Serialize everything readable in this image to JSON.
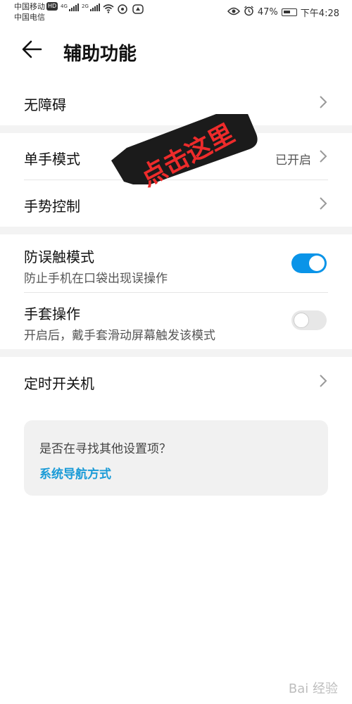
{
  "status": {
    "carrier1": "中国移动",
    "carrier2": "中国电信",
    "hd_badge": "HD",
    "net1": "4G",
    "net2": "2G",
    "battery_pct": "47%",
    "time": "下午4:28"
  },
  "header": {
    "title": "辅助功能"
  },
  "items": {
    "accessibility": {
      "label": "无障碍"
    },
    "one_hand": {
      "label": "单手模式",
      "value": "已开启"
    },
    "gesture": {
      "label": "手势控制"
    },
    "anti_touch": {
      "label": "防误触模式",
      "desc": "防止手机在口袋出现误操作",
      "enabled": true
    },
    "glove": {
      "label": "手套操作",
      "desc": "开启后，戴手套滑动屏幕触发该模式",
      "enabled": false
    },
    "schedule": {
      "label": "定时开关机"
    }
  },
  "suggestion": {
    "question": "是否在寻找其他设置项？",
    "link": "系统导航方式"
  },
  "annotation": {
    "text": "点击这里"
  },
  "watermark": {
    "text": "Bai 经验"
  },
  "colors": {
    "toggle_on": "#0a94e8",
    "link": "#1a9bd7",
    "annotation_text": "#ee2b2b"
  }
}
